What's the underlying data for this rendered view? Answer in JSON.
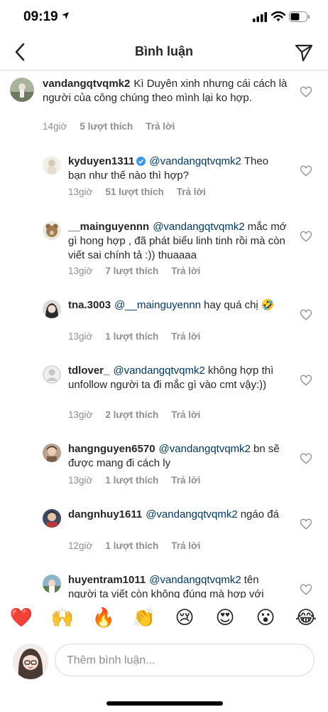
{
  "status": {
    "time": "09:19"
  },
  "header": {
    "title": "Bình luận"
  },
  "comments": [
    {
      "username": "vandangqtvqmk2",
      "mention": "",
      "text": "Kì Duyên xinh nhưng cái cách là người của công chúng theo mình lại ko hợp.",
      "time": "14giờ",
      "likes": "5 lượt thích",
      "reply": "Trả lời"
    },
    {
      "username": "kyduyen1311",
      "mention": "@vandangqtvqmk2",
      "text": "Theo bạn như thế nào thì hợp?",
      "time": "13giờ",
      "likes": "51 lượt thích",
      "reply": "Trả lời"
    },
    {
      "username": "__mainguyennn",
      "mention": "@vandangqtvqmk2",
      "text": "mắc mớ gì hong hợp , đã phát biểu linh tinh rồi mà còn viết sai chính tả :)) thuaaaa",
      "time": "13giờ",
      "likes": "7 lượt thích",
      "reply": "Trả lời"
    },
    {
      "username": "tna.3003",
      "mention": "@__mainguyennn",
      "text": "hay quá chị 🤣",
      "time": "13giờ",
      "likes": "1 lượt thích",
      "reply": "Trả lời"
    },
    {
      "username": "tdlover_",
      "mention": "@vandangqtvqmk2",
      "text": "không hợp thì unfollow người ta đi mắc gì vào cmt vậy:))",
      "time": "13giờ",
      "likes": "2 lượt thích",
      "reply": "Trả lời"
    },
    {
      "username": "hangnguyen6570",
      "mention": "@vandangqtvqmk2",
      "text": "bn sẽ được mang đi cách ly",
      "time": "13giờ",
      "likes": "1 lượt thích",
      "reply": "Trả lời"
    },
    {
      "username": "dangnhuy1611",
      "mention": "@vandangqtvqmk2",
      "text": "ngáo đá",
      "time": "12giờ",
      "likes": "1 lượt thích",
      "reply": "Trả lời"
    },
    {
      "username": "huyentram1011",
      "mention": "@vandangqtvqmk2",
      "text": "tên người ta viết còn không đúng mà hợp với",
      "time": "",
      "likes": "",
      "reply": ""
    }
  ],
  "emoji_bar": [
    "❤️",
    "🙌",
    "🔥",
    "👏",
    "😢",
    "😍",
    "😮",
    "😂"
  ],
  "composer": {
    "placeholder": "Thêm bình luận..."
  },
  "colors": {
    "mention": "#00376b",
    "meta": "#8e8e8e",
    "verified": "#3897f0"
  },
  "icons": [
    "location-arrow-icon",
    "signal-icon",
    "wifi-icon",
    "battery-icon",
    "back-chevron-icon",
    "send-icon",
    "heart-outline-icon",
    "verified-badge-icon"
  ]
}
